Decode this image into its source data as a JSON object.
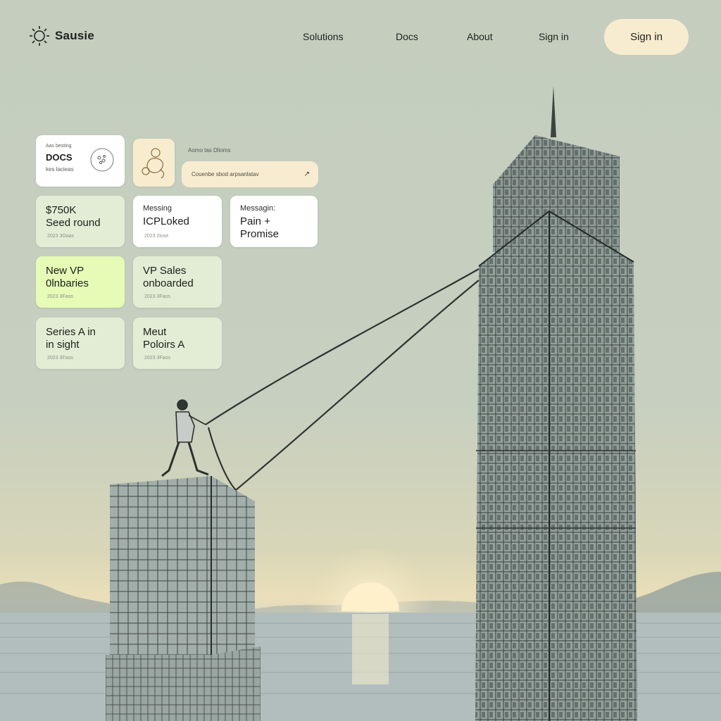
{
  "brand": {
    "name": "Sausie"
  },
  "nav": {
    "items": [
      "Solutions",
      "Docs",
      "About",
      "Sign in"
    ],
    "cta": "Sign in"
  },
  "cards": {
    "docs": {
      "kicker": "Aas besting",
      "title": "DOCS",
      "caption": "kes lacieas"
    },
    "label_small": "Aomo tas Dlioms",
    "search_pill": {
      "text": "Couenbe sbod arpsanlatav",
      "arrow": "↗"
    },
    "seed": {
      "title": "$750K\nSeed round",
      "meta": "2023 3Oaas"
    },
    "icp": {
      "kicker": "Messing",
      "title": "ICPLoked",
      "meta": "2023 2iose"
    },
    "messaging": {
      "kicker": "Messagin:",
      "title": "Pain + Promise"
    },
    "newvp": {
      "title": "New VP\n0lnbaries",
      "meta": "2023 3Faos"
    },
    "vpsales": {
      "title": "VP Sales\nonboarded",
      "meta": "2023 3Faos"
    },
    "seriesa": {
      "title": "Series A in\nin sight",
      "meta": "2023 3Faos"
    },
    "meut": {
      "title": "Meut\nPoloirs A",
      "meta": "2023 3Faos"
    }
  },
  "colors": {
    "sky": "#c4cdbe",
    "cream": "#f8ecd0",
    "mint": "#e3edd5",
    "lime": "#e6fbb5",
    "building": "#8e9c96",
    "sun": "#fff1cf"
  },
  "icons": [
    "sun-logo-icon",
    "person-sketch-icon",
    "circle-dots-icon",
    "arrow-up-right-icon"
  ]
}
